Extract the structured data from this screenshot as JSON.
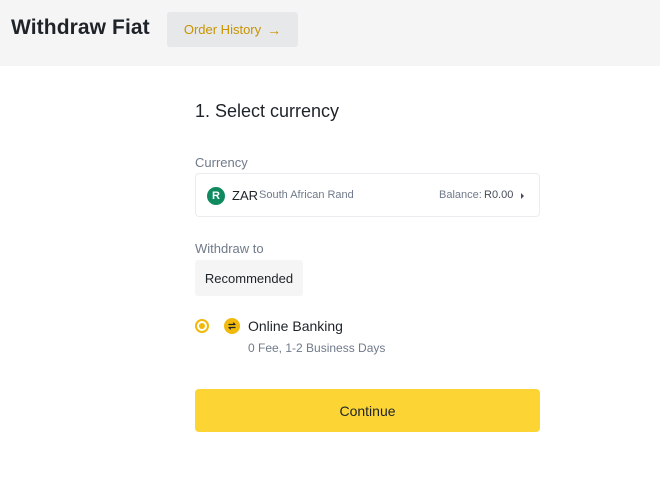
{
  "header": {
    "title": "Withdraw Fiat",
    "order_history_label": "Order History",
    "order_history_icon": "arrow-right-icon"
  },
  "step": {
    "title": "1. Select currency"
  },
  "currency": {
    "label": "Currency",
    "icon_letter": "R",
    "icon_color": "#0f8a5f",
    "code": "ZAR",
    "name": "South African Rand",
    "balance_label": "Balance:",
    "balance_value": "R0.00",
    "dropdown_icon": "caret-right-icon"
  },
  "withdraw_to": {
    "label": "Withdraw to",
    "tab_label": "Recommended",
    "method": {
      "selected": true,
      "icon": "transfer-icon",
      "title": "Online Banking",
      "subtitle": "0 Fee, 1-2 Business Days"
    }
  },
  "actions": {
    "continue_label": "Continue"
  },
  "colors": {
    "accent": "#fcd535",
    "radio": "#f0b90b",
    "link": "#c99400"
  }
}
